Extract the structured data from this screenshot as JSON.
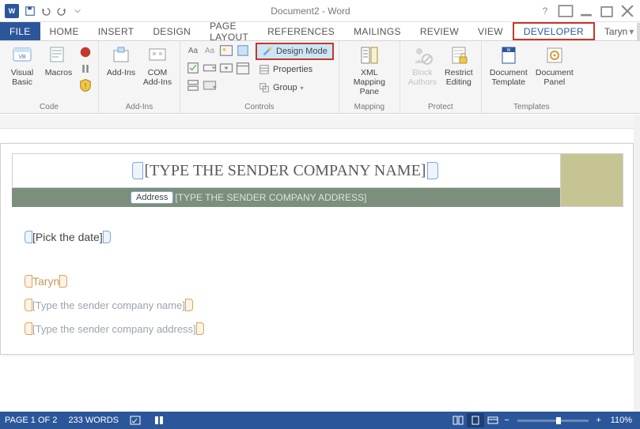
{
  "title": "Document2 - Word",
  "qat": {
    "save": "save-icon",
    "undo": "undo-icon",
    "redo": "redo-icon"
  },
  "tabs": {
    "file": "FILE",
    "items": [
      "HOME",
      "INSERT",
      "DESIGN",
      "PAGE LAYOUT",
      "REFERENCES",
      "MAILINGS",
      "REVIEW",
      "VIEW"
    ],
    "developer": "DEVELOPER",
    "user": "Taryn"
  },
  "ribbon": {
    "code": {
      "label": "Code",
      "visual_basic": "Visual\nBasic",
      "macros": "Macros"
    },
    "addins": {
      "label": "Add-Ins",
      "addins_btn": "Add-Ins",
      "com": "COM\nAdd-Ins"
    },
    "controls": {
      "label": "Controls",
      "design_mode": "Design Mode",
      "properties": "Properties",
      "group": "Group"
    },
    "mapping": {
      "label": "Mapping",
      "xml_pane": "XML Mapping\nPane"
    },
    "protect": {
      "label": "Protect",
      "block_authors": "Block\nAuthors",
      "restrict": "Restrict\nEditing"
    },
    "templates": {
      "label": "Templates",
      "doc_template": "Document\nTemplate",
      "doc_panel": "Document\nPanel"
    }
  },
  "doc": {
    "company_name_ph": "[TYPE THE SENDER COMPANY NAME]",
    "address_label": "Address",
    "address_ph": "[TYPE THE SENDER COMPANY ADDRESS]",
    "date_ph": "[Pick the date]",
    "sender_name": "Taryn",
    "sender_company_ph": "[Type the sender company name]",
    "sender_address_ph": "[Type the sender company address]"
  },
  "status": {
    "page": "PAGE 1 OF 2",
    "words": "233 WORDS",
    "zoom": "110%"
  }
}
